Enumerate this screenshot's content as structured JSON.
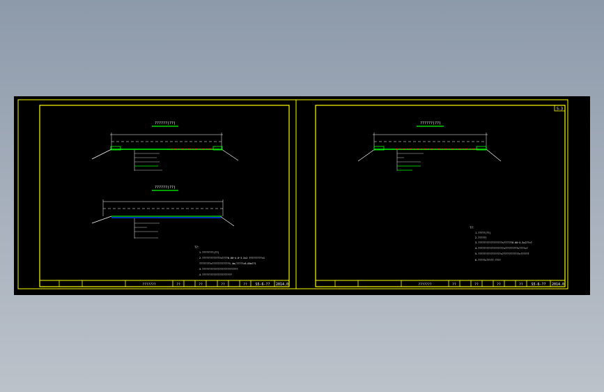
{
  "colors": {
    "background_top": "#8d9aaa",
    "background_bottom": "#bcc2ca",
    "paper": "#000000",
    "frame": "#ffff00",
    "line": "#ffffff",
    "road_surface": "#00c000",
    "centerline": "#ff3030",
    "highlight": "#00ff00",
    "water": "#0040ff"
  },
  "icons": [
    "cad-drawing-sheet"
  ],
  "left_sheet": {
    "section_title_1": "??????(??)",
    "section_title_2": "??????(??)",
    "notes_heading": "??：",
    "notes_lines": [
      "1.????????(??)",
      "2.?????????????×????0.00~4.0~3.5x2 ?????????×1",
      "????????×????????????1.4m(?????×8.05m??1",
      "3.?????????????????????????",
      "4.?????????????????????"
    ],
    "title_block": {
      "name": "???????",
      "cells": [
        "??",
        "??",
        "??",
        "??"
      ],
      "drawing_no": "S5-6-??",
      "date": "2014.0"
    }
  },
  "right_sheet": {
    "sheet_badge": "S-3",
    "section_title": "??????(??)",
    "notes_heading": "??：",
    "notes_lines": [
      "1.?????(??)",
      "2.??????",
      "3.?????????????????×??????0.00~3.5x2??×?",
      "4.??????????????????×?????????×????×?",
      "5.????????????????×????????????×??????",
      "6.?????×?????·????"
    ],
    "title_block": {
      "name": "???????",
      "cells": [
        "??",
        "??",
        "??",
        "??"
      ],
      "drawing_no": "S5-6-??",
      "date": "2014.0"
    }
  }
}
